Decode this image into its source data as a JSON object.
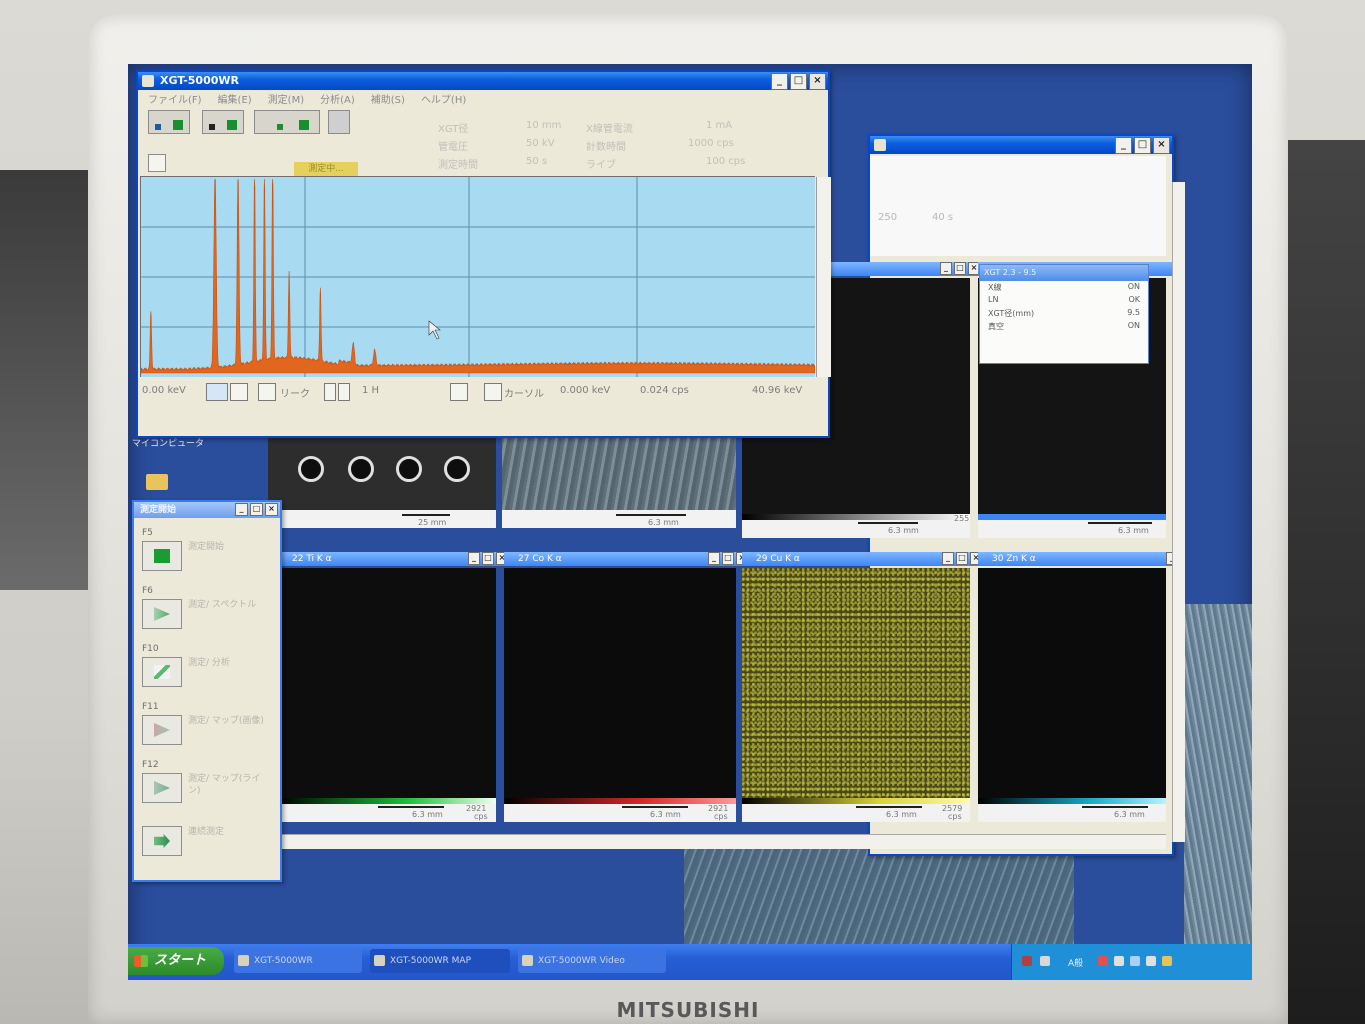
{
  "monitor": {
    "brand": "MITSUBISHI",
    "corner_logo": ""
  },
  "main_window": {
    "title": "XGT-5000WR",
    "menus": [
      "ファイル(F)",
      "編集(E)",
      "測定(M)",
      "分析(A)",
      "補助(S)",
      "ヘルプ(H)"
    ],
    "status_highlight": "測定中...",
    "info_rows": [
      [
        "XGT径",
        "10 mm",
        "X線管電流",
        "1 mA",
        ""
      ],
      [
        "管電圧",
        "50 kV",
        "計数時間",
        "100 s",
        "1000 cps"
      ],
      [
        "測定時間",
        "50 s",
        "ライブ",
        "",
        "100 cps"
      ]
    ],
    "axis": {
      "start": "0.00 keV",
      "end": "40.96 keV",
      "cursor_label": "カーソル",
      "cursor_kev": "0.000 keV",
      "cursor_cps": "0.024 cps",
      "mode": "リーク",
      "channel": "1 H"
    }
  },
  "maps_window": {
    "cells_top": [
      {
        "title": "",
        "scale": "25 mm",
        "max": ""
      },
      {
        "title": "",
        "scale": "6.3 mm",
        "max": ""
      },
      {
        "title": "",
        "scale": "6.3 mm",
        "max": "255"
      },
      {
        "title": "XGT 2.3 - 9.5",
        "scale": "6.3 mm",
        "max": ""
      }
    ],
    "cells_bottom": [
      {
        "title": "22 Ti K α",
        "scale": "6.3 mm",
        "max": "2921",
        "unit": "cps"
      },
      {
        "title": "27 Co K α",
        "scale": "6.3 mm",
        "max": "2921",
        "unit": "cps"
      },
      {
        "title": "29 Cu K α",
        "scale": "6.3 mm",
        "max": "2579",
        "unit": "cps"
      },
      {
        "title": "30 Zn K α",
        "scale": "6.3 mm",
        "max": "",
        "unit": ""
      }
    ],
    "top_values": [
      "250",
      "40 s"
    ]
  },
  "popup": {
    "title": "XGT 2.3 - 9.5",
    "rows": [
      [
        "X線",
        "ON"
      ],
      [
        "LN",
        "OK"
      ],
      [
        "XGT径(mm)",
        "9.5"
      ],
      [
        "真空",
        "ON"
      ]
    ]
  },
  "panel": {
    "title": "測定開始",
    "groups": [
      {
        "label": "F5",
        "text": "測定開始",
        "icon": "stop-icon"
      },
      {
        "label": "F6",
        "text": "測定/ スペクトル",
        "icon": "play-icon"
      },
      {
        "label": "F10",
        "text": "測定/ 分析",
        "icon": "analysis-icon"
      },
      {
        "label": "F11",
        "text": "測定/ マップ(画像)",
        "icon": "play-icon"
      },
      {
        "label": "F12",
        "text": "測定/ マップ(ライン)",
        "icon": "play-icon"
      },
      {
        "label": "",
        "text": "連続測定",
        "icon": "next-icon"
      }
    ]
  },
  "desktop": {
    "icon_label": "マイコンピュータ"
  },
  "taskbar": {
    "start_label": "スタート",
    "buttons": [
      "XGT-5000WR",
      "XGT-5000WR MAP",
      "XGT-5000WR Video"
    ],
    "tray_ime": "A般",
    "time": ""
  },
  "colors": {
    "spectrum_fill": "#e2661e",
    "spectrum_bg": "#a8daf1",
    "title_blue": "#0a5fe0",
    "ti_map": "#1fbf3a",
    "co_map": "#d8282a",
    "cu_map": "#b7b52f"
  },
  "spectrum_data": {
    "type": "area",
    "x_unit": "keV",
    "x_range": [
      0,
      40.96
    ],
    "peaks_kev": [
      0.6,
      4.5,
      5.9,
      6.9,
      7.5,
      8.0,
      9.0,
      10.9,
      12.9,
      14.2
    ]
  }
}
